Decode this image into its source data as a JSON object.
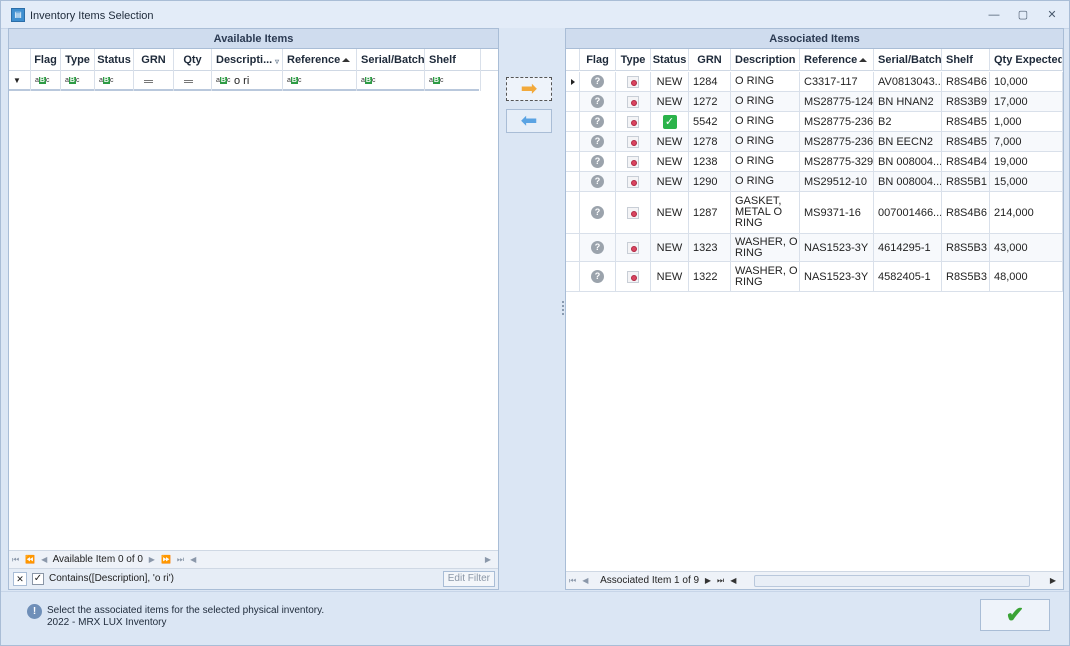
{
  "window": {
    "title": "Inventory Items Selection",
    "icon": "app-icon",
    "controls": [
      "minimize-icon",
      "restore-icon",
      "close-icon"
    ]
  },
  "available": {
    "title": "Available Items",
    "columns": [
      "Flag",
      "Type",
      "Status",
      "GRN",
      "Qty",
      "Descripti...",
      "Reference",
      "Serial/Batch",
      "Shelf"
    ],
    "filter_row": {
      "description_value": "o ri"
    },
    "navigator_text": "Available Item 0 of 0",
    "filter_text": "Contains([Description], 'o ri')",
    "edit_filter_label": "Edit Filter"
  },
  "associated": {
    "title": "Associated Items",
    "columns": [
      "Flag",
      "Type",
      "Status",
      "GRN",
      "Description",
      "Reference",
      "Serial/Batch",
      "Shelf",
      "Qty Expected"
    ],
    "rows": [
      {
        "status": "NEW",
        "grn": "1284",
        "description": "O RING",
        "reference": "C3317-117",
        "serial": "AV0813043...",
        "shelf": "R8S4B6",
        "qty": "10,000",
        "current": true
      },
      {
        "status": "NEW",
        "grn": "1272",
        "description": "O RING",
        "reference": "MS28775-124",
        "serial": "BN HNAN2",
        "shelf": "R8S3B9",
        "qty": "17,000"
      },
      {
        "status": "check",
        "grn": "5542",
        "description": "O RING",
        "reference": "MS28775-236",
        "serial": "B2",
        "shelf": "R8S4B5",
        "qty": "1,000"
      },
      {
        "status": "NEW",
        "grn": "1278",
        "description": "O RING",
        "reference": "MS28775-236",
        "serial": "BN EECN2",
        "shelf": "R8S4B5",
        "qty": "7,000"
      },
      {
        "status": "NEW",
        "grn": "1238",
        "description": "O RING",
        "reference": "MS28775-329",
        "serial": "BN 008004...",
        "shelf": "R8S4B4",
        "qty": "19,000"
      },
      {
        "status": "NEW",
        "grn": "1290",
        "description": "O RING",
        "reference": "MS29512-10",
        "serial": "BN 008004...",
        "shelf": "R8S5B1",
        "qty": "15,000"
      },
      {
        "status": "NEW",
        "grn": "1287",
        "description": "GASKET, METAL O RING",
        "reference": "MS9371-16",
        "serial": "007001466...",
        "shelf": "R8S4B6",
        "qty": "214,000"
      },
      {
        "status": "NEW",
        "grn": "1323",
        "description": "WASHER, O RING",
        "reference": "NAS1523-3Y",
        "serial": "4614295-1",
        "shelf": "R8S5B3",
        "qty": "43,000"
      },
      {
        "status": "NEW",
        "grn": "1322",
        "description": "WASHER, O RING",
        "reference": "NAS1523-3Y",
        "serial": "4582405-1",
        "shelf": "R8S5B3",
        "qty": "48,000"
      }
    ],
    "navigator_text": "Associated Item 1 of 9"
  },
  "footer": {
    "info_line1": "Select the associated items for the selected physical inventory.",
    "info_line2": "2022 - MRX LUX Inventory"
  },
  "colors": {
    "accent_check": "#2bb34a",
    "header_bg": "#cfdcee",
    "move_right_arrow": "#f2a93b",
    "move_left_arrow": "#5aa3e3"
  }
}
